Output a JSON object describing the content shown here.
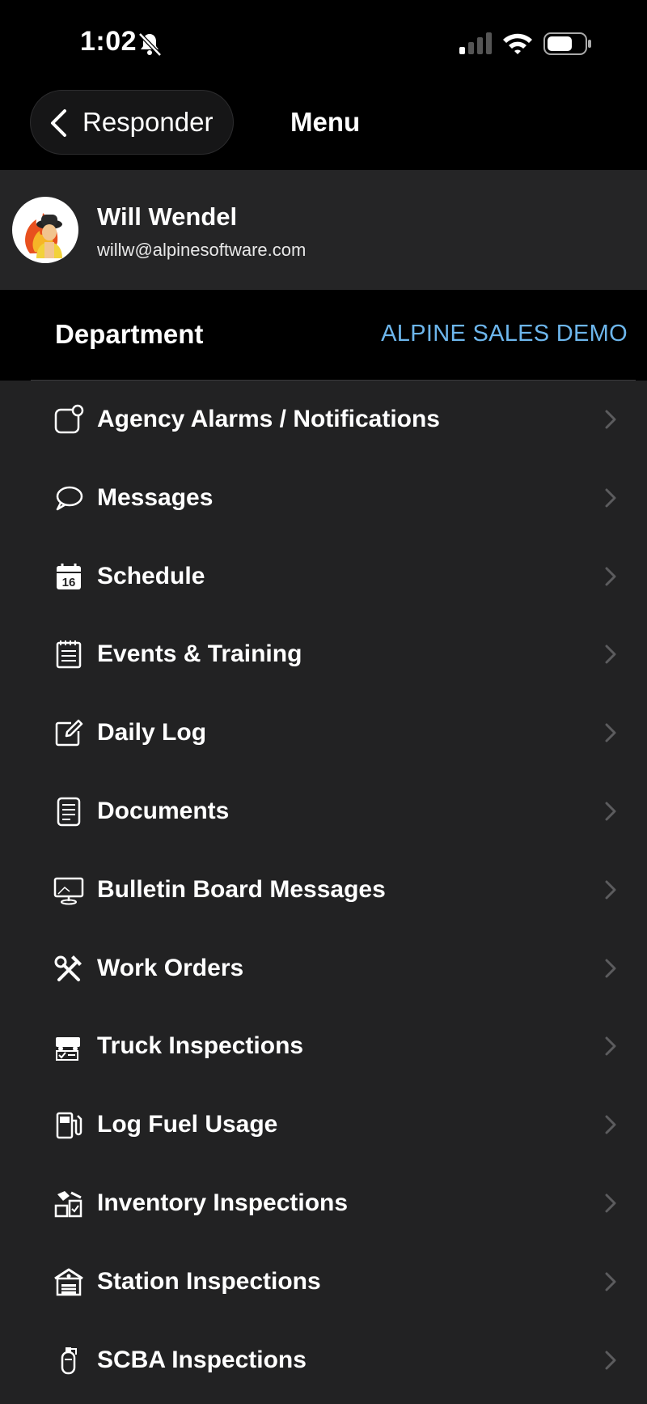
{
  "status": {
    "time": "1:02"
  },
  "nav": {
    "back_label": "Responder",
    "title": "Menu"
  },
  "profile": {
    "name": "Will Wendel",
    "email": "willw@alpinesoftware.com"
  },
  "department": {
    "label": "Department",
    "value": "ALPINE SALES DEMO"
  },
  "menu": {
    "items": [
      {
        "label": "Agency Alarms / Notifications",
        "icon": "notification-icon"
      },
      {
        "label": "Messages",
        "icon": "chat-bubble-icon"
      },
      {
        "label": "Schedule",
        "icon": "calendar-icon"
      },
      {
        "label": "Events & Training",
        "icon": "notepad-icon"
      },
      {
        "label": "Daily Log",
        "icon": "edit-icon"
      },
      {
        "label": "Documents",
        "icon": "document-icon"
      },
      {
        "label": "Bulletin Board Messages",
        "icon": "monitor-icon"
      },
      {
        "label": "Work Orders",
        "icon": "tools-icon"
      },
      {
        "label": "Truck Inspections",
        "icon": "truck-inspection-icon"
      },
      {
        "label": "Log Fuel Usage",
        "icon": "fuel-pump-icon"
      },
      {
        "label": "Inventory Inspections",
        "icon": "inventory-icon"
      },
      {
        "label": "Station Inspections",
        "icon": "station-icon"
      },
      {
        "label": "SCBA Inspections",
        "icon": "scba-tank-icon"
      }
    ]
  },
  "colors": {
    "accent": "#6db6ec",
    "background": "#222223",
    "header": "#000000"
  }
}
